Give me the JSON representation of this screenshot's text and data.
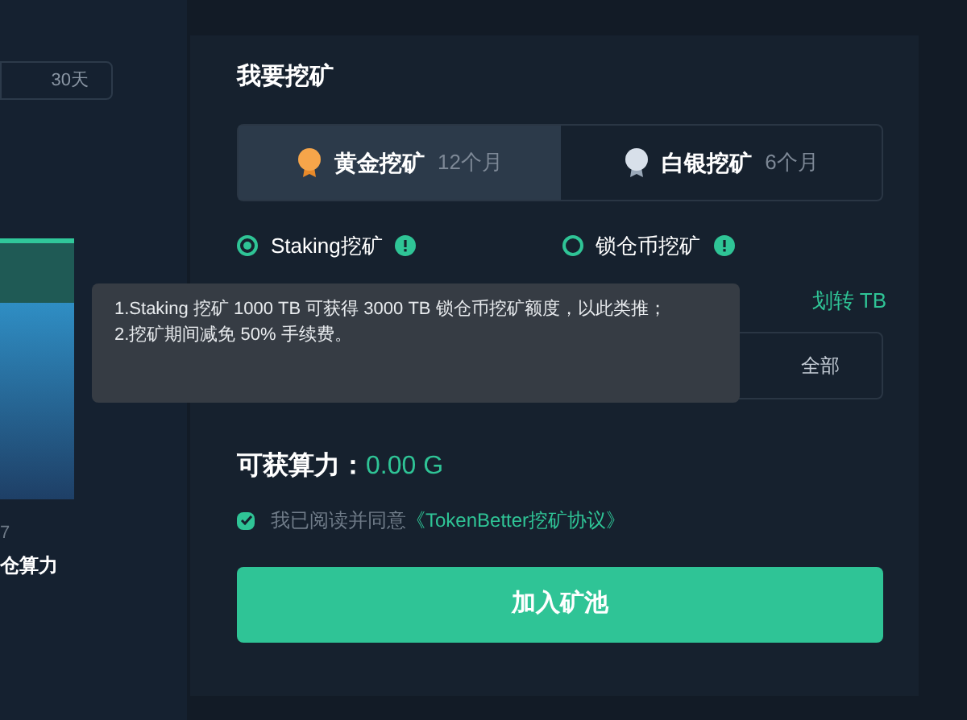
{
  "left_panel": {
    "period": "30天",
    "axis_label": "7",
    "caption": "仓算力"
  },
  "title": "我要挖矿",
  "plans": [
    {
      "kind": "gold",
      "name": "黄金挖矿",
      "term": "12个月",
      "selected": true
    },
    {
      "kind": "silver",
      "name": "白银挖矿",
      "term": "6个月",
      "selected": false
    }
  ],
  "modes": [
    {
      "label": "Staking挖矿",
      "selected": true
    },
    {
      "label": "锁仓币挖矿",
      "selected": false
    }
  ],
  "tooltip": [
    "1.Staking 挖矿 1000 TB 可获得 3000 TB 锁仓币挖矿额度，以此类推；",
    "2.挖矿期间减免 50% 手续费。"
  ],
  "transfer_link": "划转 TB",
  "amount": {
    "max_button": "全部"
  },
  "hashrate": {
    "label": "可获算力：",
    "value": "0.00 G"
  },
  "agreement": {
    "checked": true,
    "text": "我已阅读并同意",
    "link": "《TokenBetter挖矿协议》"
  },
  "submit": "加入矿池"
}
